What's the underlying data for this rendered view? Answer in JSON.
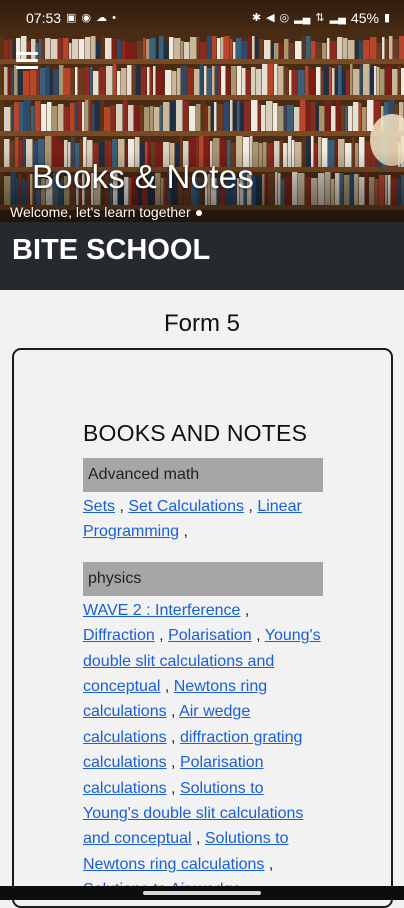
{
  "status": {
    "time": "07:53",
    "battery": "45%",
    "left_icons": [
      "image-icon",
      "whatsapp-icon",
      "cloud-icon",
      "dot-icon"
    ],
    "right_icons": [
      "bluetooth-icon",
      "mute-icon",
      "hotspot-icon",
      "signal-icon",
      "wifi-icon",
      "signal-icon",
      "battery-icon"
    ]
  },
  "hero": {
    "title": "Books & Notes",
    "subtitle": "Welcome, let's learn together"
  },
  "appbar": {
    "title": "BITE SCHOOL"
  },
  "page": {
    "heading": "Form 5"
  },
  "content": {
    "title": "BOOKS AND NOTES",
    "subjects": [
      {
        "name": "Advanced math",
        "links": [
          "Sets",
          "Set Calculations",
          "Linear Programming"
        ]
      },
      {
        "name": "physics",
        "links": [
          "WAVE 2 : Interference",
          "Diffraction",
          "Polarisation",
          "Young's double slit calculations and conceptual",
          "Newtons ring calculations",
          "Air wedge calculations",
          "diffraction grating calculations",
          "Polarisation calculations",
          "Solutions to Young's double slit calculations and conceptual",
          "Solutions to Newtons ring calculations",
          "Solutions to Air wedge"
        ]
      }
    ]
  },
  "colors": {
    "appbar": "#262a2f",
    "subject_bar": "#a6a6a6",
    "link": "#1a5fd6",
    "background": "#f2f2f2"
  }
}
